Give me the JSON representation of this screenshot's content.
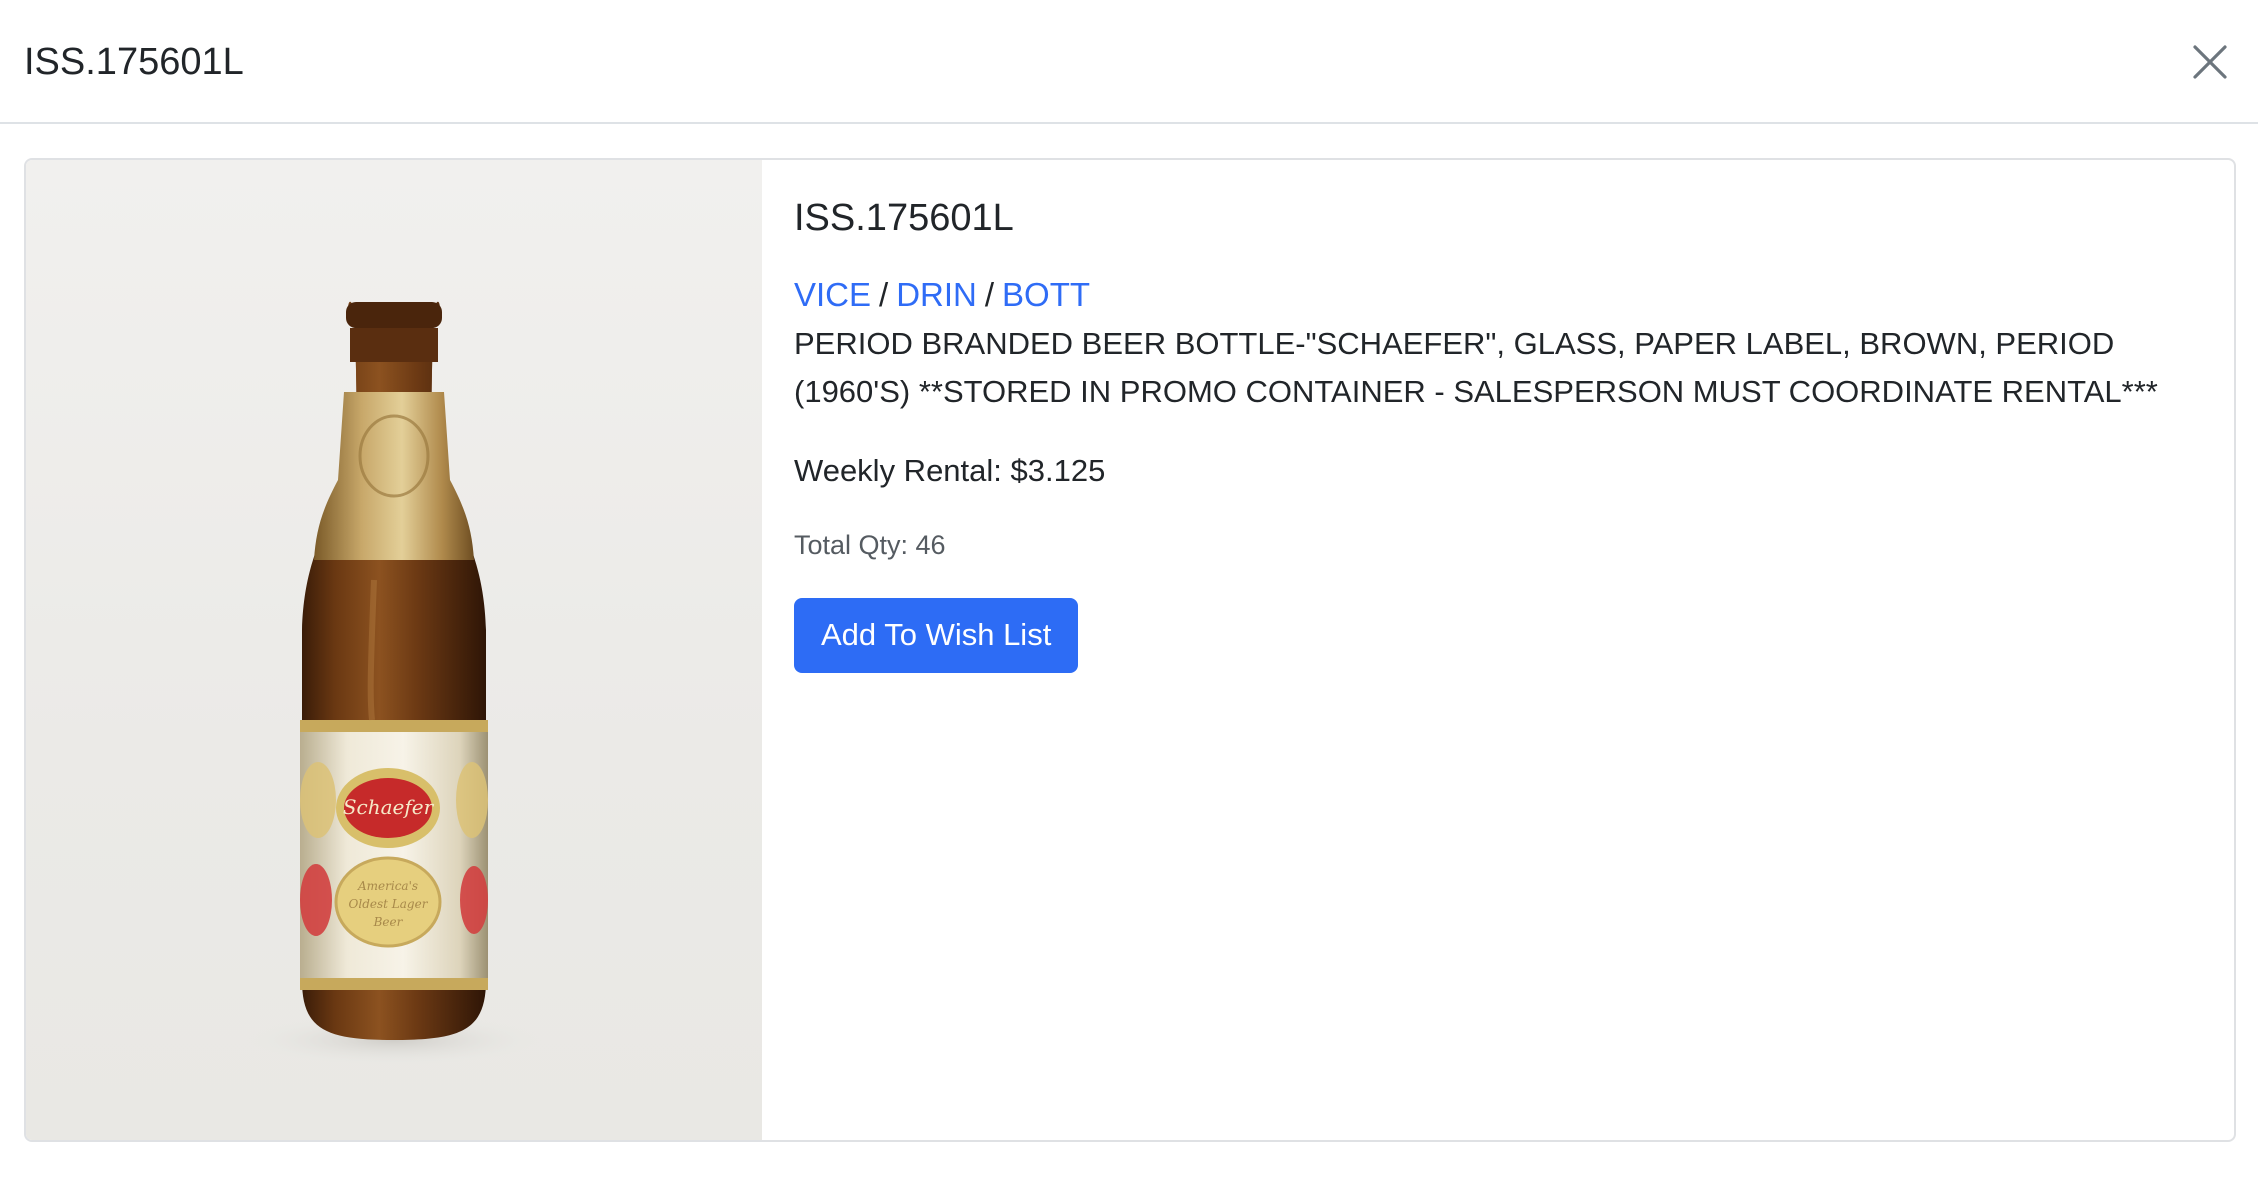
{
  "header": {
    "title": "ISS.175601L",
    "close_icon": "close-icon"
  },
  "item": {
    "title": "ISS.175601L",
    "image_icon": "beer-bottle-photo",
    "image_label_text": "Schaefer",
    "image_label_subtext": "America's Oldest Lager Beer",
    "breadcrumb": [
      "VICE",
      "DRIN",
      "BOTT"
    ],
    "breadcrumb_separator": "/",
    "description": "PERIOD BRANDED BEER BOTTLE-\"SCHAEFER\", GLASS, PAPER LABEL, BROWN, PERIOD (1960'S) **STORED IN PROMO CONTAINER - SALESPERSON MUST COORDINATE RENTAL***",
    "weekly_rental": "Weekly Rental: $3.125",
    "total_qty": "Total Qty: 46",
    "wish_button_label": "Add To Wish List"
  },
  "colors": {
    "link": "#2f6cf6",
    "button": "#2d6cf5",
    "text": "#212529",
    "muted": "#555b61"
  }
}
